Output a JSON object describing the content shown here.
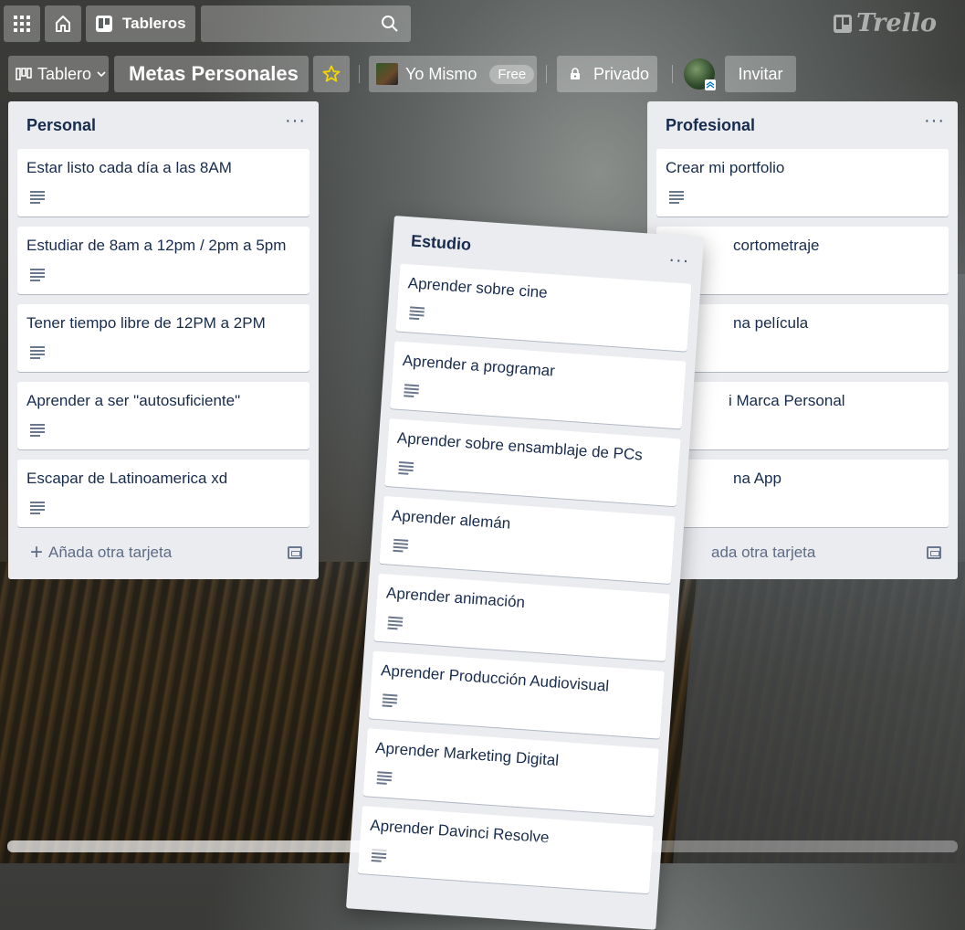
{
  "header": {
    "boards_label": "Tableros",
    "search_placeholder": "",
    "logo_text": "Trello"
  },
  "board_bar": {
    "view_label": "Tablero",
    "board_title": "Metas Personales",
    "team_name": "Yo Mismo",
    "team_badge": "Free",
    "visibility_label": "Privado",
    "invite_label": "Invitar"
  },
  "lists": [
    {
      "title": "Personal",
      "cards": [
        "Estar listo cada día a las 8AM",
        "Estudiar de 8am a 12pm / 2pm a 5pm",
        "Tener tiempo libre de 12PM a 2PM",
        "Aprender a ser \"autosuficiente\"",
        "Escapar de Latinoamerica xd"
      ],
      "add_card_label": "Añada otra tarjeta"
    },
    {
      "title": "Profesional",
      "cards": [
        "Crear mi portfolio",
        "cortometraje",
        "na película",
        "i Marca Personal",
        "na App"
      ],
      "add_card_label": "ada otra tarjeta"
    }
  ],
  "dragging_list": {
    "title": "Estudio",
    "cards": [
      "Aprender sobre cine",
      "Aprender a programar",
      "Aprender sobre ensamblaje de PCs",
      "Aprender alemán",
      "Aprender animación",
      "Aprender Producción Audiovisual",
      "Aprender Marketing Digital",
      "Aprender Davinci Resolve"
    ]
  },
  "colors": {
    "list_bg": "#ebecf0",
    "card_text": "#172b4d",
    "star": "#f2d600"
  }
}
